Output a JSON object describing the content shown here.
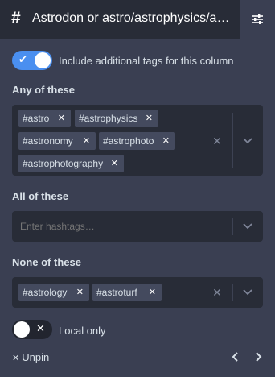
{
  "header": {
    "icon": "hashtag-icon",
    "title": "Astrodon or astro/astrophysics/a…",
    "settings_icon": "sliders-icon"
  },
  "include_tags": {
    "enabled": true,
    "label": "Include additional tags for this column"
  },
  "any_of": {
    "label": "Any of these",
    "tags": [
      "#astro",
      "#astrophysics",
      "#astronomy",
      "#astrophoto",
      "#astrophotography"
    ]
  },
  "all_of": {
    "label": "All of these",
    "placeholder": "Enter hashtags…"
  },
  "none_of": {
    "label": "None of these",
    "tags": [
      "#astrology",
      "#astroturf"
    ]
  },
  "local_only": {
    "enabled": false,
    "label": "Local only"
  },
  "footer": {
    "unpin_label": "Unpin"
  },
  "colors": {
    "accent": "#4a8ff0",
    "panel": "#3a3f52",
    "field": "#282c37",
    "tag": "#444a5e"
  }
}
